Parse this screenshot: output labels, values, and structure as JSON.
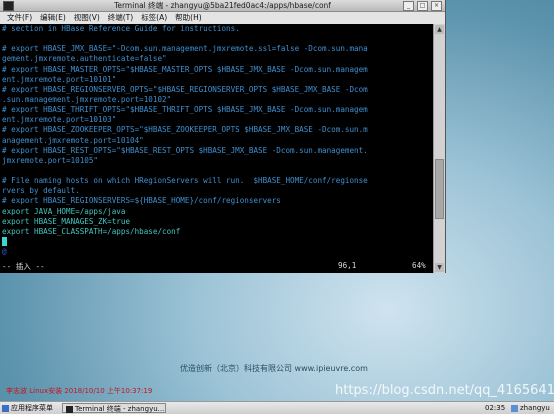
{
  "window": {
    "title": "Terminal 终端 - zhangyu@5ba21fed0ac4:/apps/hbase/conf",
    "menu": [
      "文件(F)",
      "编辑(E)",
      "视图(V)",
      "终端(T)",
      "标签(A)",
      "帮助(H)"
    ]
  },
  "terminal": {
    "lines": [
      {
        "text": "# section in HBase Reference Guide for instructions.",
        "style": "comment"
      },
      {
        "text": "",
        "style": "comment"
      },
      {
        "text": "# export HBASE_JMX_BASE=\"-Dcom.sun.management.jmxremote.ssl=false -Dcom.sun.mana",
        "style": "comment"
      },
      {
        "text": "gement.jmxremote.authenticate=false\"",
        "style": "comment"
      },
      {
        "text": "# export HBASE_MASTER_OPTS=\"$HBASE_MASTER_OPTS $HBASE_JMX_BASE -Dcom.sun.managem",
        "style": "comment"
      },
      {
        "text": "ent.jmxremote.port=10101\"",
        "style": "comment"
      },
      {
        "text": "# export HBASE_REGIONSERVER_OPTS=\"$HBASE_REGIONSERVER_OPTS $HBASE_JMX_BASE -Dcom",
        "style": "comment"
      },
      {
        "text": ".sun.management.jmxremote.port=10102\"",
        "style": "comment"
      },
      {
        "text": "# export HBASE_THRIFT_OPTS=\"$HBASE_THRIFT_OPTS $HBASE_JMX_BASE -Dcom.sun.managem",
        "style": "comment"
      },
      {
        "text": "ent.jmxremote.port=10103\"",
        "style": "comment"
      },
      {
        "text": "# export HBASE_ZOOKEEPER_OPTS=\"$HBASE_ZOOKEEPER_OPTS $HBASE_JMX_BASE -Dcom.sun.m",
        "style": "comment"
      },
      {
        "text": "anagement.jmxremote.port=10104\"",
        "style": "comment"
      },
      {
        "text": "# export HBASE_REST_OPTS=\"$HBASE_REST_OPTS $HBASE_JMX_BASE -Dcom.sun.management.",
        "style": "comment"
      },
      {
        "text": "jmxremote.port=10105\"",
        "style": "comment"
      },
      {
        "text": "",
        "style": "comment"
      },
      {
        "text": "# File naming hosts on which HRegionServers will run.  $HBASE_HOME/conf/regionse",
        "style": "comment"
      },
      {
        "text": "rvers by default.",
        "style": "comment"
      },
      {
        "text": "# export HBASE_REGIONSERVERS=${HBASE_HOME}/conf/regionservers",
        "style": "comment"
      },
      {
        "text": "export JAVA_HOME=/apps/java",
        "style": "code"
      },
      {
        "text": "export HBASE_MANAGES_ZK=true",
        "style": "code"
      },
      {
        "text": "export HBASE_CLASSPATH=/apps/hbase/conf",
        "style": "code"
      },
      {
        "text": "",
        "style": "cursor"
      },
      {
        "text": "@",
        "style": "tilde"
      }
    ],
    "status_mode": "-- 插入 --",
    "status_position": "96,1",
    "status_percent": "64%"
  },
  "desktop": {
    "watermark_center": "优造创新（北京）科技有限公司 www.ipieuvre.com",
    "watermark_left": "李志波 Linux安装  2018/10/10 上午10:37:19",
    "watermark_csdn": "https://blog.csdn.net/qq_41656414"
  },
  "taskbar": {
    "start_menu": "应用程序菜单",
    "task_terminal": "Terminal 终端 - zhangyu...",
    "clock": "02:35",
    "user": "zhangyu"
  }
}
